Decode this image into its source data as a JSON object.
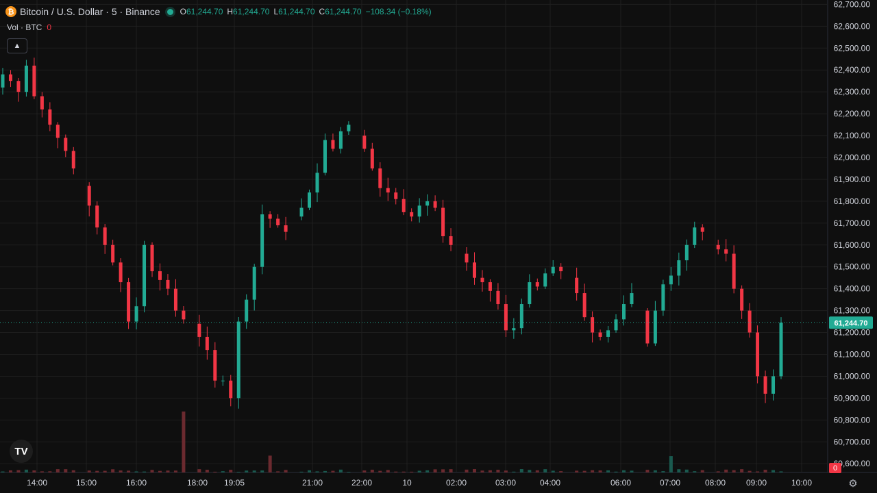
{
  "header": {
    "coin_symbol": "₿",
    "title": "Bitcoin / U.S. Dollar · 5 · Binance",
    "o_label": "O",
    "o_value": "61,244.70",
    "h_label": "H",
    "h_value": "61,244.70",
    "l_label": "L",
    "l_value": "61,244.70",
    "c_label": "C",
    "c_value": "61,244.70",
    "change": "−108.34 (−0.18%)"
  },
  "volume": {
    "label": "Vol · BTC",
    "value": "0"
  },
  "collapse_icon": "chevron-up-icon",
  "tv_logo": "TV",
  "colors": {
    "up": "#22ab94",
    "down": "#f23645",
    "bg": "#0f0f0f",
    "grid": "#1f1f1f",
    "text": "#d1d4dc"
  },
  "chart_data": {
    "type": "candlestick",
    "y_axis": {
      "ticks": [
        "62,700.00",
        "62,600.00",
        "62,500.00",
        "62,400.00",
        "62,300.00",
        "62,200.00",
        "62,100.00",
        "62,000.00",
        "61,900.00",
        "61,800.00",
        "61,700.00",
        "61,600.00",
        "61,500.00",
        "61,400.00",
        "61,300.00",
        "61,200.00",
        "61,100.00",
        "61,000.00",
        "60,900.00",
        "60,800.00",
        "60,700.00",
        "60,600.00"
      ],
      "range": [
        60560,
        62720
      ]
    },
    "x_axis": {
      "ticks": [
        "14:00",
        "15:00",
        "16:00",
        "18:00",
        "19:05",
        "21:00",
        "22:00",
        "10",
        "02:00",
        "03:00",
        "04:00",
        "06:00",
        "07:00",
        "08:00",
        "09:00",
        "10:00"
      ]
    },
    "last_price": {
      "label": "61,244.70",
      "value": 61244.7
    },
    "volume_label": "0",
    "closes": [
      62380,
      62350,
      62300,
      62420,
      62280,
      62220,
      62150,
      62090,
      62030,
      61950,
      61870,
      61780,
      61680,
      61600,
      61520,
      61430,
      61250,
      61320,
      61600,
      61480,
      61440,
      61400,
      61300,
      61260,
      61240,
      61180,
      61120,
      60980,
      60980,
      60900,
      61250,
      61350,
      61500,
      61740,
      61720,
      61690,
      61660,
      61730,
      61770,
      61840,
      61930,
      62080,
      62040,
      62120,
      62150,
      62100,
      62040,
      61950,
      61860,
      61840,
      61810,
      61750,
      61730,
      61780,
      61800,
      61770,
      61640,
      61600,
      61560,
      61520,
      61450,
      61430,
      61390,
      61330,
      61210,
      61220,
      61330,
      61430,
      61410,
      61470,
      61500,
      61480,
      61450,
      61380,
      61270,
      61200,
      61180,
      61210,
      61260,
      61330,
      61380,
      61300,
      61150,
      61300,
      61420,
      61460,
      61530,
      61600,
      61680,
      61660,
      61600,
      61580,
      61560,
      61400,
      61300,
      61200,
      61000,
      60920,
      61000,
      61244.7
    ],
    "note": "Approximate 5-minute candlestick series read from the chart."
  }
}
